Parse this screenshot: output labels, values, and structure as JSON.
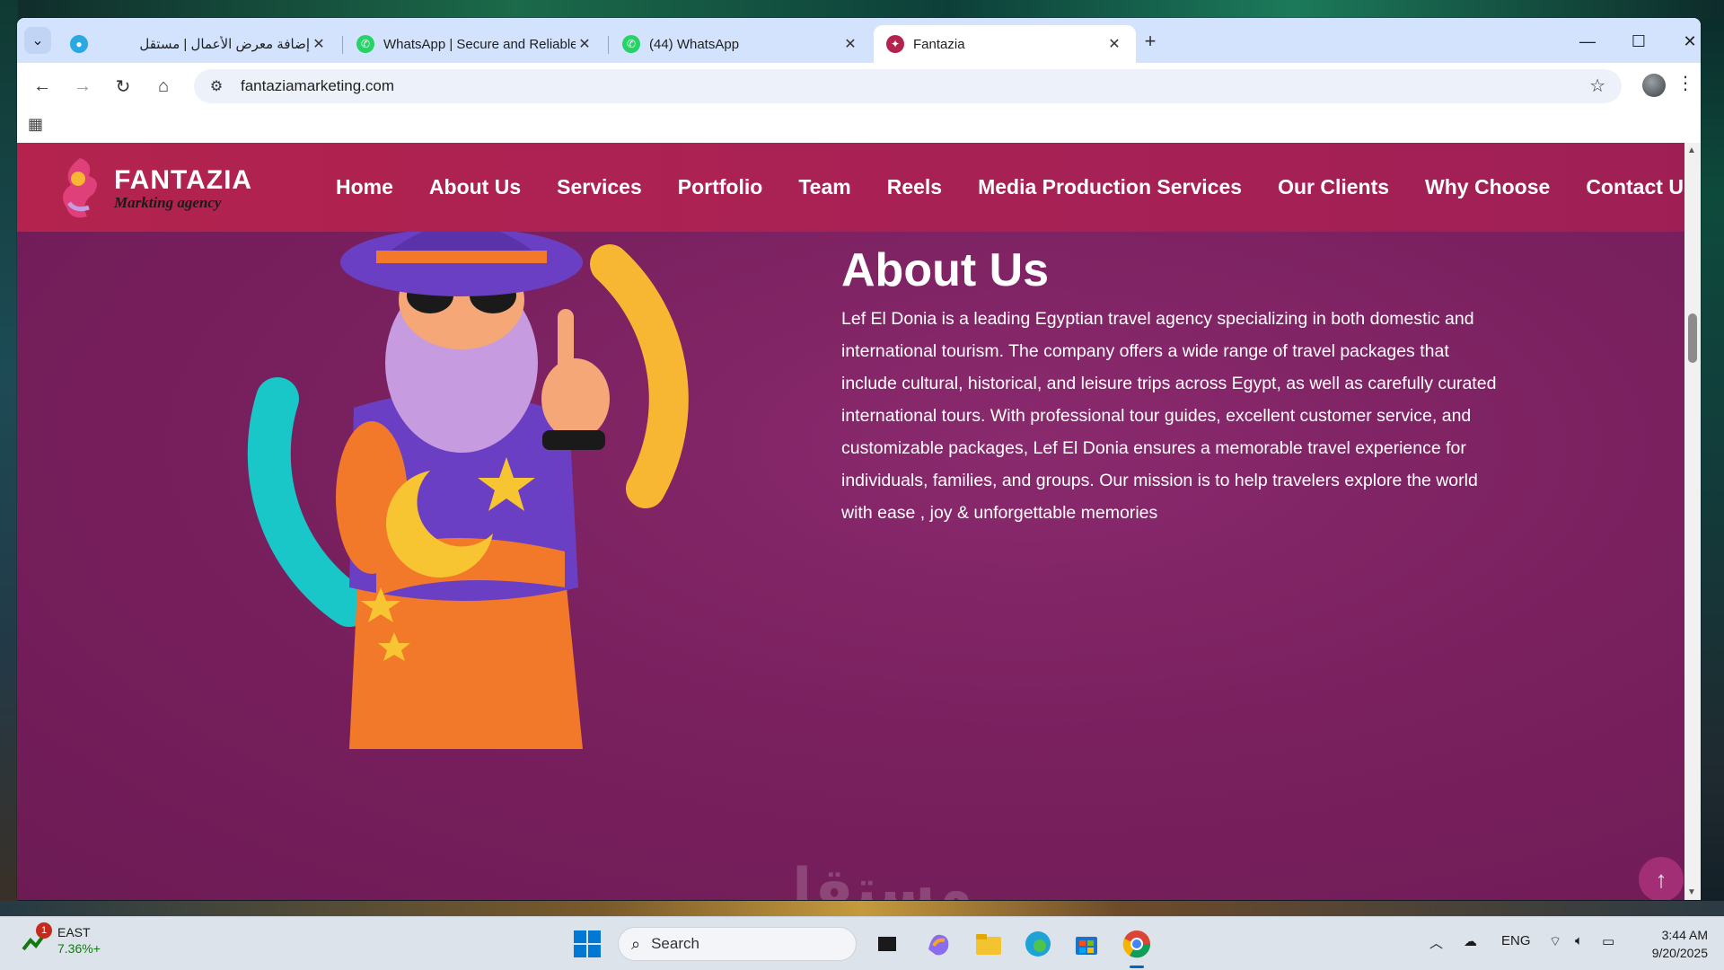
{
  "browser": {
    "tabs": [
      {
        "title": "إضافة معرض الأعمال | مستقل",
        "favicon": "mostaql-icon",
        "active": false
      },
      {
        "title": "WhatsApp | Secure and Reliable",
        "favicon": "whatsapp-icon",
        "active": false
      },
      {
        "title": "(44) WhatsApp",
        "favicon": "whatsapp-icon",
        "active": false
      },
      {
        "title": "Fantazia",
        "favicon": "fantazia-icon",
        "active": true
      }
    ],
    "new_tab_label": "+",
    "url": "fantaziamarketing.com",
    "minimize": "—",
    "maximize": "☐",
    "close": "✕"
  },
  "site": {
    "logo_name": "FANTAZIA",
    "logo_sub": "Markting agency",
    "nav": [
      "Home",
      "About Us",
      "Services",
      "Portfolio",
      "Team",
      "Reels",
      "Media Production Services",
      "Our Clients",
      "Why Choose",
      "Contact Us"
    ],
    "about_title": "About Us",
    "about_text": "Lef El Donia is a leading Egyptian travel agency specializing in both domestic and international tourism. The company offers a wide range of travel packages that include cultural, historical, and leisure trips across Egypt, as well as carefully curated international tours. With professional tour guides, excellent customer service, and customizable packages, Lef El Donia ensures a memorable travel experience for individuals, families, and groups. Our mission is to help travelers explore the world with ease , joy & unforgettable memories",
    "scroll_top_glyph": "↑",
    "colors": {
      "header": "#b3234e",
      "page_bg": "#7a205f",
      "accent_teal": "#19c6c8",
      "accent_yellow": "#f7b733"
    }
  },
  "taskbar": {
    "stock_name": "EAST",
    "stock_value": "7.36%+",
    "stock_badge": "1",
    "search_label": "Search",
    "language": "ENG",
    "time": "3:44 AM",
    "date": "9/20/2025"
  },
  "watermark": "مستقل"
}
